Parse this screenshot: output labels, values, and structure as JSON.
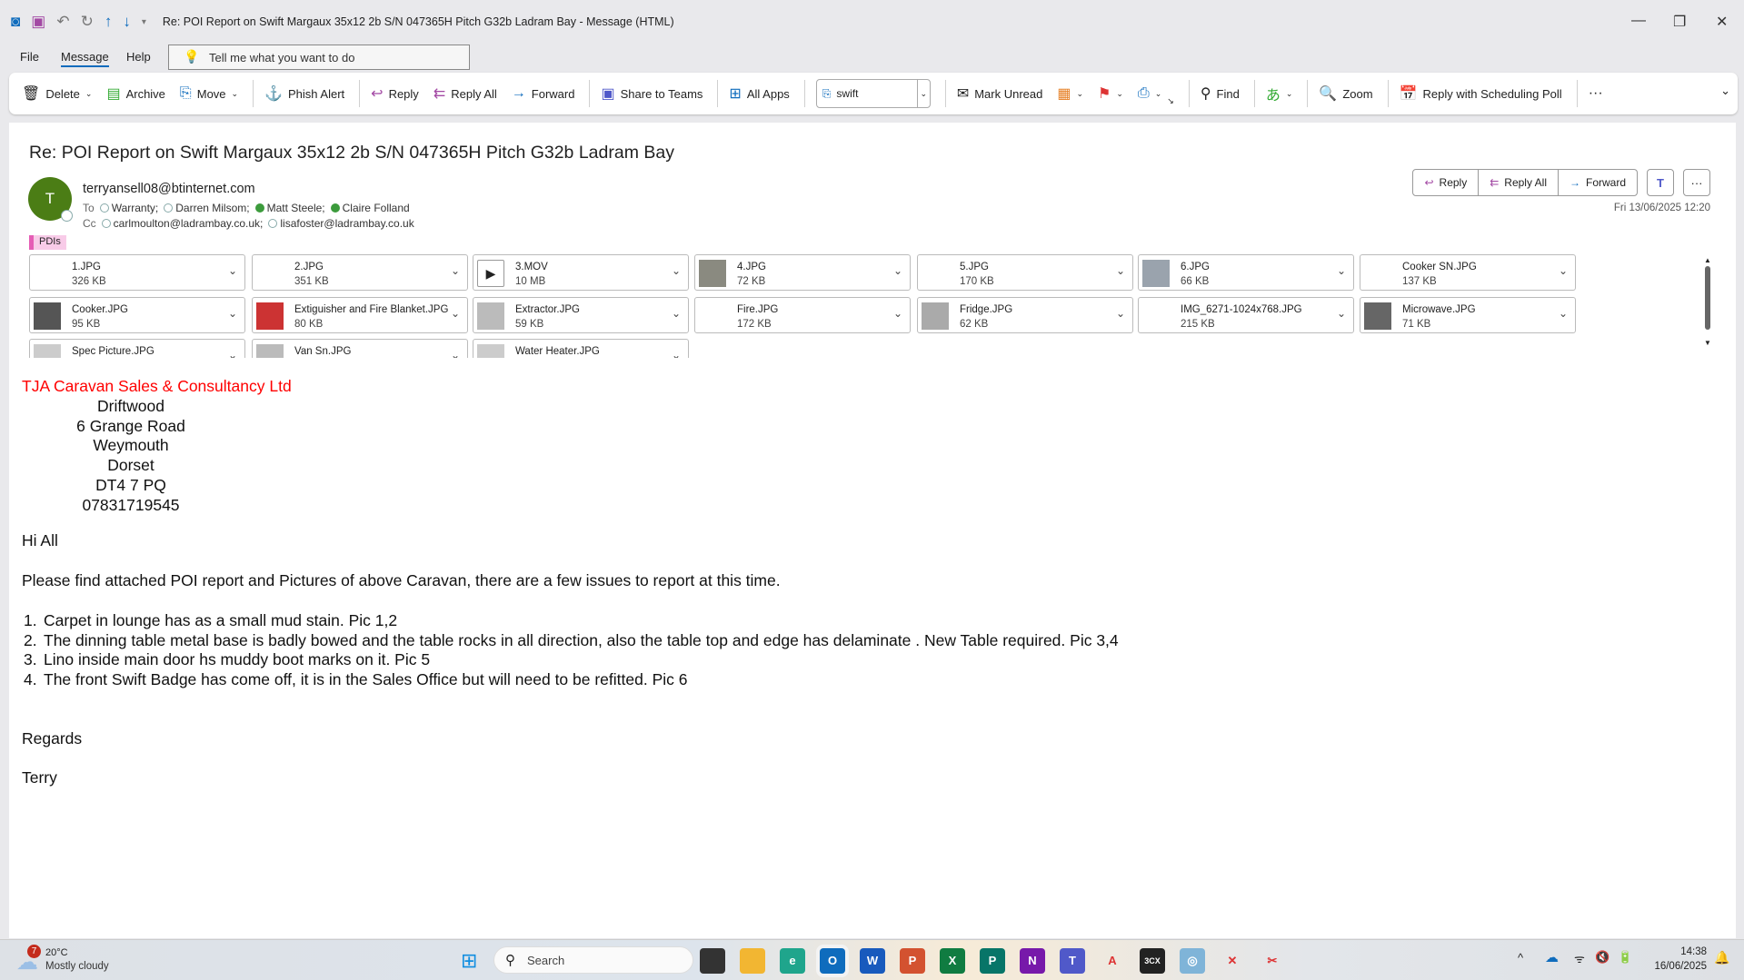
{
  "window": {
    "title": "Re: POI Report on  Swift Margaux 35x12 2b S/N 047365H Pitch G32b Ladram Bay  -  Message (HTML)"
  },
  "menu": {
    "items": [
      "File",
      "Message",
      "Help"
    ],
    "tell_me": "Tell me what you want to do"
  },
  "ribbon": {
    "delete": "Delete",
    "archive": "Archive",
    "move": "Move",
    "phish": "Phish Alert",
    "reply": "Reply",
    "reply_all": "Reply All",
    "forward": "Forward",
    "share_teams": "Share to Teams",
    "all_apps": "All Apps",
    "quick_step": "swift",
    "mark_unread": "Mark Unread",
    "find": "Find",
    "zoom": "Zoom",
    "scheduling_poll": "Reply with Scheduling Poll"
  },
  "message": {
    "subject": "Re: POI Report on  Swift Margaux 35x12 2b S/N 047365H Pitch G32b Ladram Bay",
    "avatar_initial": "T",
    "from": "terryansell08@btinternet.com",
    "to_label": "To",
    "to": [
      "Warranty;",
      "Darren Milsom;",
      "Matt Steele;",
      "Claire Folland"
    ],
    "cc_label": "Cc",
    "cc": [
      "carlmoulton@ladrambay.co.uk;",
      "lisafoster@ladrambay.co.uk"
    ],
    "category": "PDIs",
    "date": "Fri 13/06/2025 12:20",
    "actions": {
      "reply": "Reply",
      "reply_all": "Reply All",
      "forward": "Forward"
    }
  },
  "attachments": [
    {
      "name": "1.JPG",
      "size": "326 KB",
      "thumb": ""
    },
    {
      "name": "2.JPG",
      "size": "351 KB",
      "thumb": ""
    },
    {
      "name": "3.MOV",
      "size": "10 MB",
      "thumb": "video"
    },
    {
      "name": "4.JPG",
      "size": "72 KB",
      "thumb": "#8a8a80"
    },
    {
      "name": "5.JPG",
      "size": "170 KB",
      "thumb": ""
    },
    {
      "name": "6.JPG",
      "size": "66 KB",
      "thumb": "#9aa3ad"
    },
    {
      "name": "Cooker SN.JPG",
      "size": "137 KB",
      "thumb": ""
    },
    {
      "name": "Cooker.JPG",
      "size": "95 KB",
      "thumb": "#555"
    },
    {
      "name": "Extiguisher and Fire Blanket.JPG",
      "size": "80 KB",
      "thumb": "#c33"
    },
    {
      "name": "Extractor.JPG",
      "size": "59 KB",
      "thumb": "#bbb"
    },
    {
      "name": "Fire.JPG",
      "size": "172 KB",
      "thumb": ""
    },
    {
      "name": "Fridge.JPG",
      "size": "62 KB",
      "thumb": "#aaa"
    },
    {
      "name": "IMG_6271-1024x768.JPG",
      "size": "215 KB",
      "thumb": ""
    },
    {
      "name": "Microwave.JPG",
      "size": "71 KB",
      "thumb": "#666"
    },
    {
      "name": "Spec Picture.JPG",
      "size": "",
      "thumb": "#ccc"
    },
    {
      "name": "Van Sn.JPG",
      "size": "",
      "thumb": "#bbb"
    },
    {
      "name": "Water Heater.JPG",
      "size": "",
      "thumb": "#ccc"
    }
  ],
  "body": {
    "company": "TJA Caravan Sales & Consultancy Ltd",
    "company_color": "#ff0000",
    "address": [
      "Driftwood",
      "6 Grange Road",
      "Weymouth",
      "Dorset",
      "DT4 7 PQ",
      "07831719545"
    ],
    "greeting": "Hi All",
    "intro": "Please find attached POI report and Pictures of above Caravan, there are a few issues to report at this time.",
    "issues": [
      "Carpet in lounge has as a small mud stain. Pic 1,2",
      "The dinning table metal base is badly bowed and the table rocks in all direction, also the table top and edge has delaminate . New Table required. Pic 3,4",
      "Lino inside main door hs muddy boot marks on it. Pic 5",
      "The front Swift Badge has come off, it is in the Sales Office but will need to be refitted. Pic 6"
    ],
    "signoff": "Regards",
    "name": "Terry"
  },
  "taskbar": {
    "weather_badge": "7",
    "temp": "20°C",
    "weather": "Mostly cloudy",
    "search": "Search",
    "time": "14:38",
    "date": "16/06/2025"
  }
}
